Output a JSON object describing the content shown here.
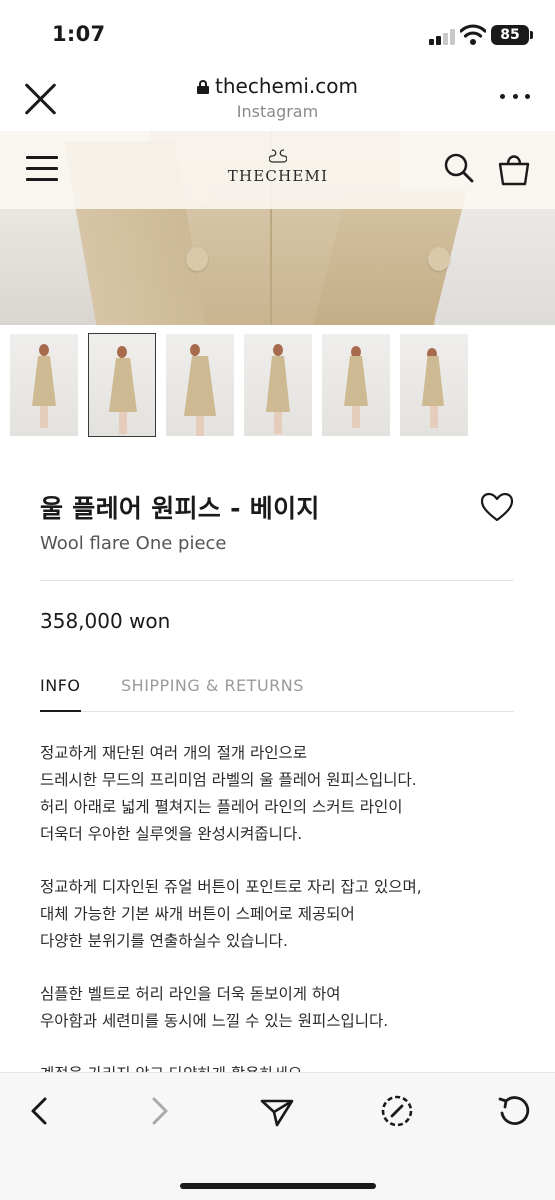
{
  "status_bar": {
    "time": "1:07",
    "battery": "85"
  },
  "browser": {
    "url": "thechemi.com",
    "source": "Instagram"
  },
  "site": {
    "logo_text": "THECHEMI"
  },
  "product": {
    "title": "울 플레어 원피스 - 베이지",
    "subtitle": "Wool flare One piece",
    "price": "358,000 won"
  },
  "tabs": [
    {
      "label": "INFO",
      "active": true
    },
    {
      "label": "SHIPPING & RETURNS",
      "active": false
    }
  ],
  "description": {
    "paragraph1": [
      "정교하게 재단된 여러 개의 절개 라인으로",
      "드레시한 무드의 프리미엄 라벨의 울 플레어 원피스입니다.",
      "허리 아래로 넓게 펼쳐지는 플레어 라인의 스커트 라인이",
      "더욱더 우아한 실루엣을 완성시켜줍니다."
    ],
    "paragraph2": [
      "정교하게 디자인된 쥬얼 버튼이 포인트로 자리 잡고 있으며,",
      "대체 가능한 기본 싸개 버튼이 스페어로 제공되어",
      "다양한 분위기를 연출하실수 있습니다."
    ],
    "paragraph3": [
      "심플한 벨트로 허리 라인을 더욱 돋보이게 하여",
      "우아함과 세련미를 동시에 느낄 수 있는 원피스입니다."
    ],
    "cut_line": "계절을 가리지 않고 다양하게 활용하세요"
  },
  "colors": {
    "text": "#1a1a1a",
    "muted": "#9a9a9a",
    "beige": "#cdb992"
  }
}
